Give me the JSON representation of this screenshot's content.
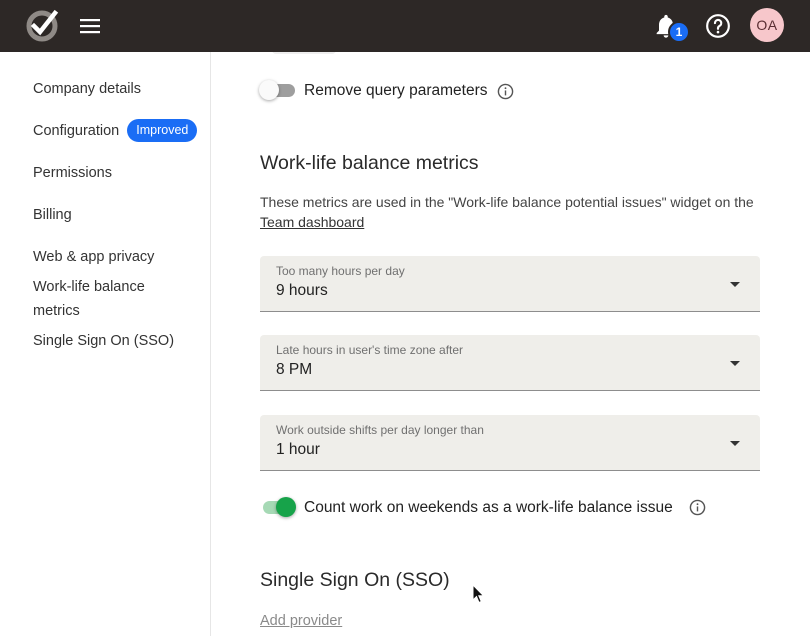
{
  "header": {
    "notification_count": "1",
    "avatar_initials": "OA"
  },
  "sidebar": {
    "items": [
      {
        "label": "Company details"
      },
      {
        "label": "Configuration",
        "badge": "Improved"
      },
      {
        "label": "Permissions"
      },
      {
        "label": "Billing"
      },
      {
        "label": "Web & app privacy"
      },
      {
        "label": "Work-life balance metrics"
      },
      {
        "label": "Single Sign On (SSO)"
      }
    ]
  },
  "main": {
    "remove_query": {
      "label": "Remove query parameters",
      "enabled": false
    },
    "worklife": {
      "heading": "Work-life balance metrics",
      "desc_prefix": "These metrics are used in the \"Work-life balance potential issues\" widget on the ",
      "desc_link": "Team dashboard",
      "selects": [
        {
          "label": "Too many hours per day",
          "value": "9 hours"
        },
        {
          "label": "Late hours in user's time zone after",
          "value": "8 PM"
        },
        {
          "label": "Work outside shifts per day longer than",
          "value": "1 hour"
        }
      ],
      "weekends": {
        "label": "Count work on weekends as a work-life balance issue",
        "enabled": true
      }
    },
    "sso": {
      "heading": "Single Sign On (SSO)",
      "add_provider": "Add provider"
    }
  },
  "colors": {
    "topbar": "#2d2826",
    "accent_blue": "#1a6df5",
    "toggle_on": "#17a34a",
    "select_bg": "#efeeea",
    "avatar_bg": "#f7c7cb"
  },
  "icons": [
    "app-logo-icon",
    "menu-icon",
    "bell-icon",
    "help-icon",
    "info-icon",
    "caret-down-icon",
    "cursor-icon"
  ]
}
